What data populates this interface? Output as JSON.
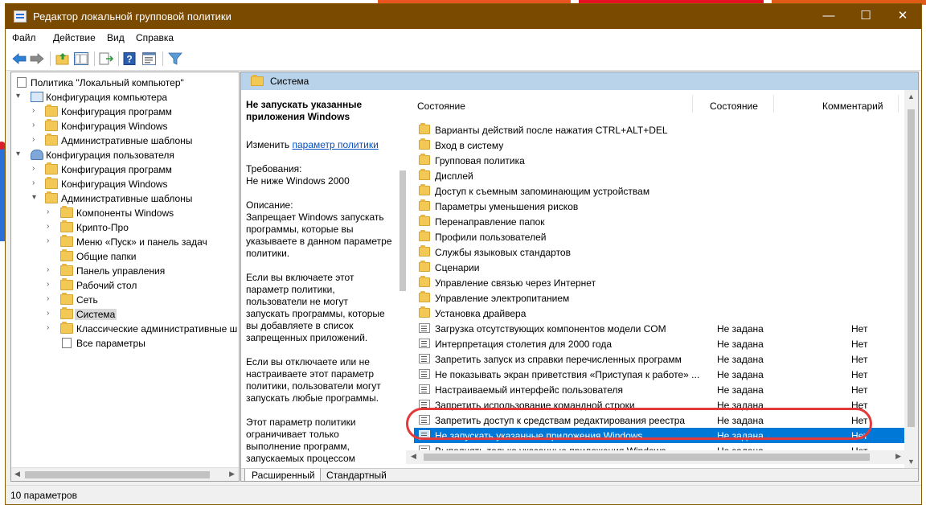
{
  "window": {
    "title": "Редактор локальной групповой политики",
    "minimize_glyph": "—",
    "maximize_glyph": "☐",
    "close_glyph": "✕"
  },
  "menu": [
    "Файл",
    "Действие",
    "Вид",
    "Справка"
  ],
  "toolbar_icons": [
    "back-arrow-icon",
    "forward-arrow-icon",
    "up-folder-icon",
    "show-hide-tree-icon",
    "export-list-icon",
    "help-icon",
    "properties-icon",
    "filter-icon"
  ],
  "tree": {
    "root": "Политика \"Локальный компьютер\"",
    "computer_config": "Конфигурация компьютера",
    "cc_programs": "Конфигурация программ",
    "cc_windows": "Конфигурация Windows",
    "cc_admin": "Административные шаблоны",
    "user_config": "Конфигурация пользователя",
    "uc_programs": "Конфигурация программ",
    "uc_windows": "Конфигурация Windows",
    "uc_admin": "Административные шаблоны",
    "admin_children": [
      "Компоненты Windows",
      "Крипто-Про",
      "Меню «Пуск» и панель задач",
      "Общие папки",
      "Панель управления",
      "Рабочий стол",
      "Сеть",
      "Система",
      "Классические административные ш",
      "Все параметры"
    ]
  },
  "section_header": "Система",
  "description": {
    "title": "Не запускать указанные приложения Windows",
    "edit_prefix": "Изменить ",
    "edit_link": "параметр политики",
    "requirements_label": "Требования:",
    "requirements_value": "Не ниже Windows 2000",
    "description_label": "Описание:",
    "para1": [
      "Запрещает Windows запускать",
      "программы, которые вы",
      "указываете в данном параметре",
      "политики."
    ],
    "para2": [
      "Если вы включаете этот",
      "параметр политики,",
      "пользователи не могут",
      "запускать программы, которые",
      "вы добавляете в список",
      "запрещенных приложений."
    ],
    "para3": [
      "Если вы отключаете или не",
      "настраиваете этот параметр",
      "политики, пользователи могут",
      "запускать любые программы."
    ],
    "para4": [
      "Этот параметр политики",
      "ограничивает только",
      "выполнение программ,",
      "запускаемых процессом"
    ]
  },
  "list": {
    "columns": [
      "Состояние",
      "Состояние",
      "Комментарий"
    ],
    "folders": [
      "Варианты действий после нажатия CTRL+ALT+DEL",
      "Вход в систему",
      "Групповая политика",
      "Дисплей",
      "Доступ к съемным запоминающим устройствам",
      "Параметры уменьшения рисков",
      "Перенаправление папок",
      "Профили пользователей",
      "Службы языковых стандартов",
      "Сценарии",
      "Управление связью через Интернет",
      "Управление электропитанием",
      "Установка драйвера"
    ],
    "policies": [
      {
        "name": "Загрузка отсутствующих компонентов модели COM",
        "state": "Не задана",
        "comment": "Нет"
      },
      {
        "name": "Интерпретация столетия для 2000 года",
        "state": "Не задана",
        "comment": "Нет"
      },
      {
        "name": "Запретить запуск из справки перечисленных программ",
        "state": "Не задана",
        "comment": "Нет"
      },
      {
        "name": "Не показывать экран приветствия «Приступая к работе» ...",
        "state": "Не задана",
        "comment": "Нет"
      },
      {
        "name": "Настраиваемый интерфейс пользователя",
        "state": "Не задана",
        "comment": "Нет"
      },
      {
        "name": "Запретить использование командной строки",
        "state": "Не задана",
        "comment": "Нет"
      },
      {
        "name": "Запретить доступ к средствам редактирования реестра",
        "state": "Не задана",
        "comment": "Нет"
      },
      {
        "name": "Не запускать указанные приложения Windows",
        "state": "Не задана",
        "comment": "Нет"
      },
      {
        "name": "Выполнять только указанные приложения Windows",
        "state": "Не задана",
        "comment": "Нет"
      }
    ],
    "selected_index": 7
  },
  "tabs": [
    "Расширенный",
    "Стандартный"
  ],
  "status": "10 параметров",
  "colors": {
    "titlebar": "#7a4a00",
    "selection": "#0078d7",
    "section_header": "#b8d3ea",
    "highlight_ring": "#e23a3a"
  }
}
